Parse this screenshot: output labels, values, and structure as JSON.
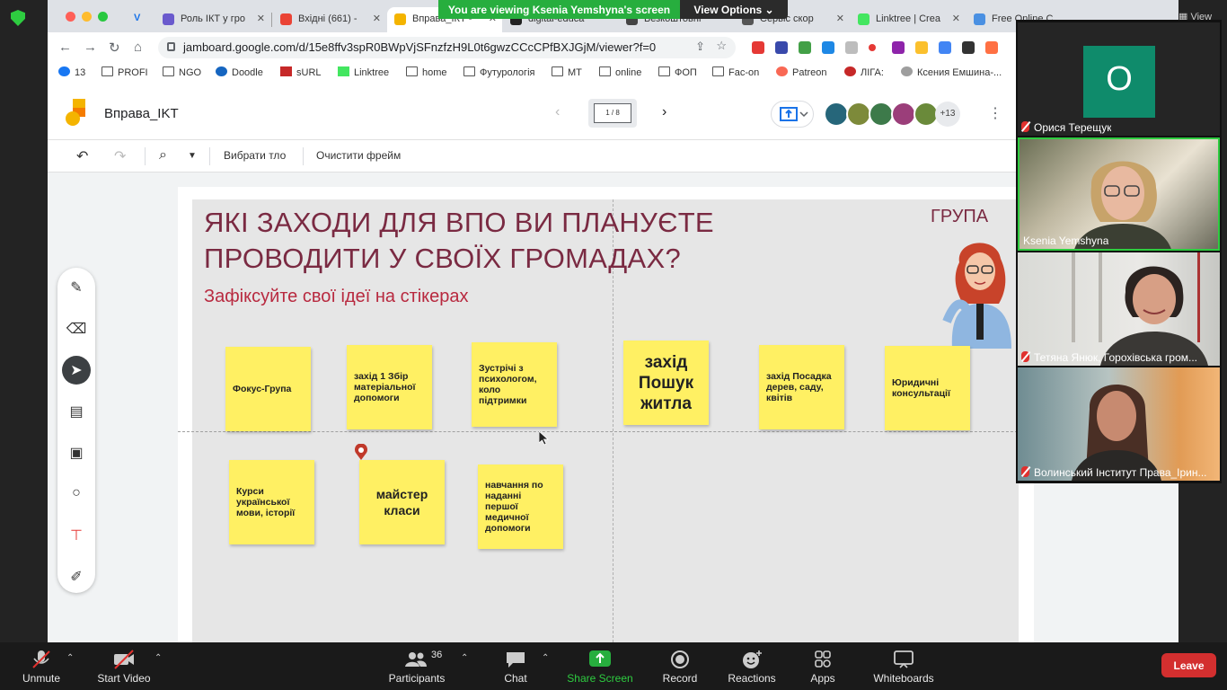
{
  "zoom": {
    "share_banner": "You are viewing Ksenia Yemshyna's screen",
    "view_options": "View Options",
    "view_label": "View"
  },
  "browser": {
    "tabs": [
      {
        "label": "Роль ІКТ у гро"
      },
      {
        "label": "Вхідні (661) -"
      },
      {
        "label": "Вправа_ІКТ -",
        "active": true
      },
      {
        "label": "digital-educa"
      },
      {
        "label": "Безкоштовні"
      },
      {
        "label": "Сервіс скор"
      },
      {
        "label": "Linktree | Crea"
      },
      {
        "label": "Free Online C"
      }
    ],
    "url": "jamboard.google.com/d/15e8ffv3spR0BWpVjSFnzfzH9L0t6gwzCCcCPfBXJGjM/viewer?f=0",
    "bookmarks": [
      "13",
      "PROFI",
      "NGO",
      "Doodle",
      "sURL",
      "Linktree",
      "home",
      "Футурологія",
      "MT",
      "online",
      "ФОП",
      "Fac-on",
      "Patreon",
      "ЛІГА:",
      "Ксения Емшина-..."
    ]
  },
  "jamboard": {
    "title": "Вправа_IKT",
    "frame_indicator": "1 / 8",
    "more_participants": "+13",
    "toolbar": {
      "set_background": "Вибрати тло",
      "clear_frame": "Очистити фрейм"
    },
    "frame": {
      "title_line1": "ЯКІ ЗАХОДИ ДЛЯ ВПО ВИ ПЛАНУЄТЕ",
      "title_line2": "ПРОВОДИТИ У СВОЇХ ГРОМАДАХ?",
      "subtitle": "Зафіксуйте свої ідеї на стікерах",
      "group_label": "ГРУПА",
      "stickies": [
        "Фокус-Група",
        "захід 1 Збір матеріальної допомоги",
        "Зустрічі з психологом, коло підтримки",
        "захід Пошук житла",
        "захід Посадка дерев, саду, квітів",
        "Юридичні консультації",
        "Курси української мови, історії",
        "майстер класи",
        "навчання по наданні першої медичної допомоги"
      ]
    }
  },
  "participants": {
    "tiles": [
      {
        "name": "Орися Терещук",
        "initial": "О",
        "muted": true
      },
      {
        "name": "Ksenia Yemshyna",
        "muted": false
      },
      {
        "name": "Тетяна Янюк, Горохівська гром...",
        "muted": true
      },
      {
        "name": "Волинський Інститут Права_Ірин...",
        "muted": true
      }
    ]
  },
  "controls": {
    "unmute": "Unmute",
    "start_video": "Start Video",
    "participants": "Participants",
    "participants_count": "36",
    "chat": "Chat",
    "share_screen": "Share Screen",
    "record": "Record",
    "reactions": "Reactions",
    "apps": "Apps",
    "whiteboards": "Whiteboards",
    "leave": "Leave"
  },
  "colors": {
    "sticky": "#fff063",
    "title": "#7a2a42",
    "subtitle": "#b8293f",
    "share_green": "#27ae3e",
    "leave_red": "#d32f2f"
  }
}
